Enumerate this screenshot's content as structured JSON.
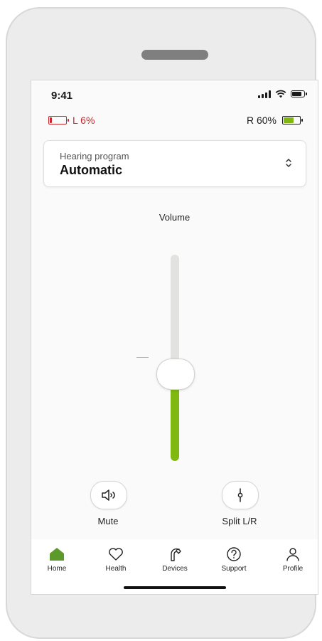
{
  "status_bar": {
    "time": "9:41"
  },
  "batteries": {
    "left": {
      "label": "L 6%",
      "color": "#c8272b"
    },
    "right": {
      "label": "R 60%",
      "color": "#7fb810"
    }
  },
  "program": {
    "label": "Hearing program",
    "value": "Automatic"
  },
  "volume": {
    "label": "Volume",
    "level": 0.42
  },
  "controls": {
    "mute_label": "Mute",
    "split_label": "Split L/R"
  },
  "tabs": [
    {
      "label": "Home",
      "icon": "home-icon",
      "active": true
    },
    {
      "label": "Health",
      "icon": "heart-icon",
      "active": false
    },
    {
      "label": "Devices",
      "icon": "hearing-aid-icon",
      "active": false
    },
    {
      "label": "Support",
      "icon": "question-icon",
      "active": false
    },
    {
      "label": "Profile",
      "icon": "person-icon",
      "active": false
    }
  ],
  "colors": {
    "accent": "#7fb810",
    "active_tab": "#5d9a2c",
    "warning": "#c8272b"
  }
}
